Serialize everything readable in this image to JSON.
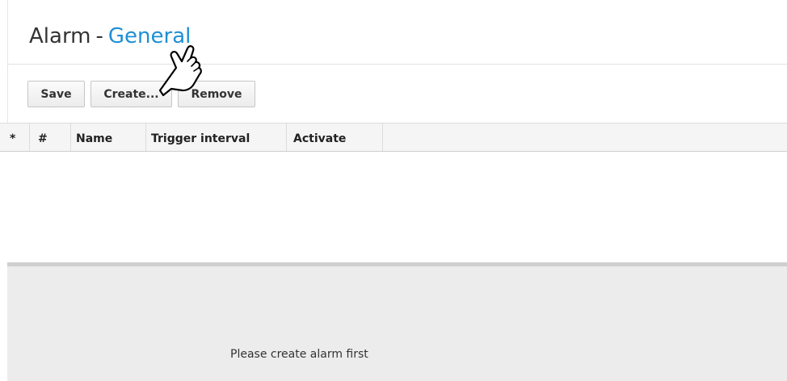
{
  "page": {
    "title": "Alarm",
    "separator": "-",
    "section": "General"
  },
  "toolbar": {
    "save_label": "Save",
    "create_label": "Create...",
    "remove_label": "Remove"
  },
  "table": {
    "columns": [
      "*",
      "#",
      "Name",
      "Trigger interval",
      "Activate"
    ],
    "rows": []
  },
  "detail": {
    "empty_message": "Please create alarm first"
  },
  "colors": {
    "accent": "#1e8fd5",
    "panel_background": "#ececec",
    "header_background": "#f5f5f5"
  },
  "icons": {
    "cursor": "hand-pointer-icon"
  }
}
